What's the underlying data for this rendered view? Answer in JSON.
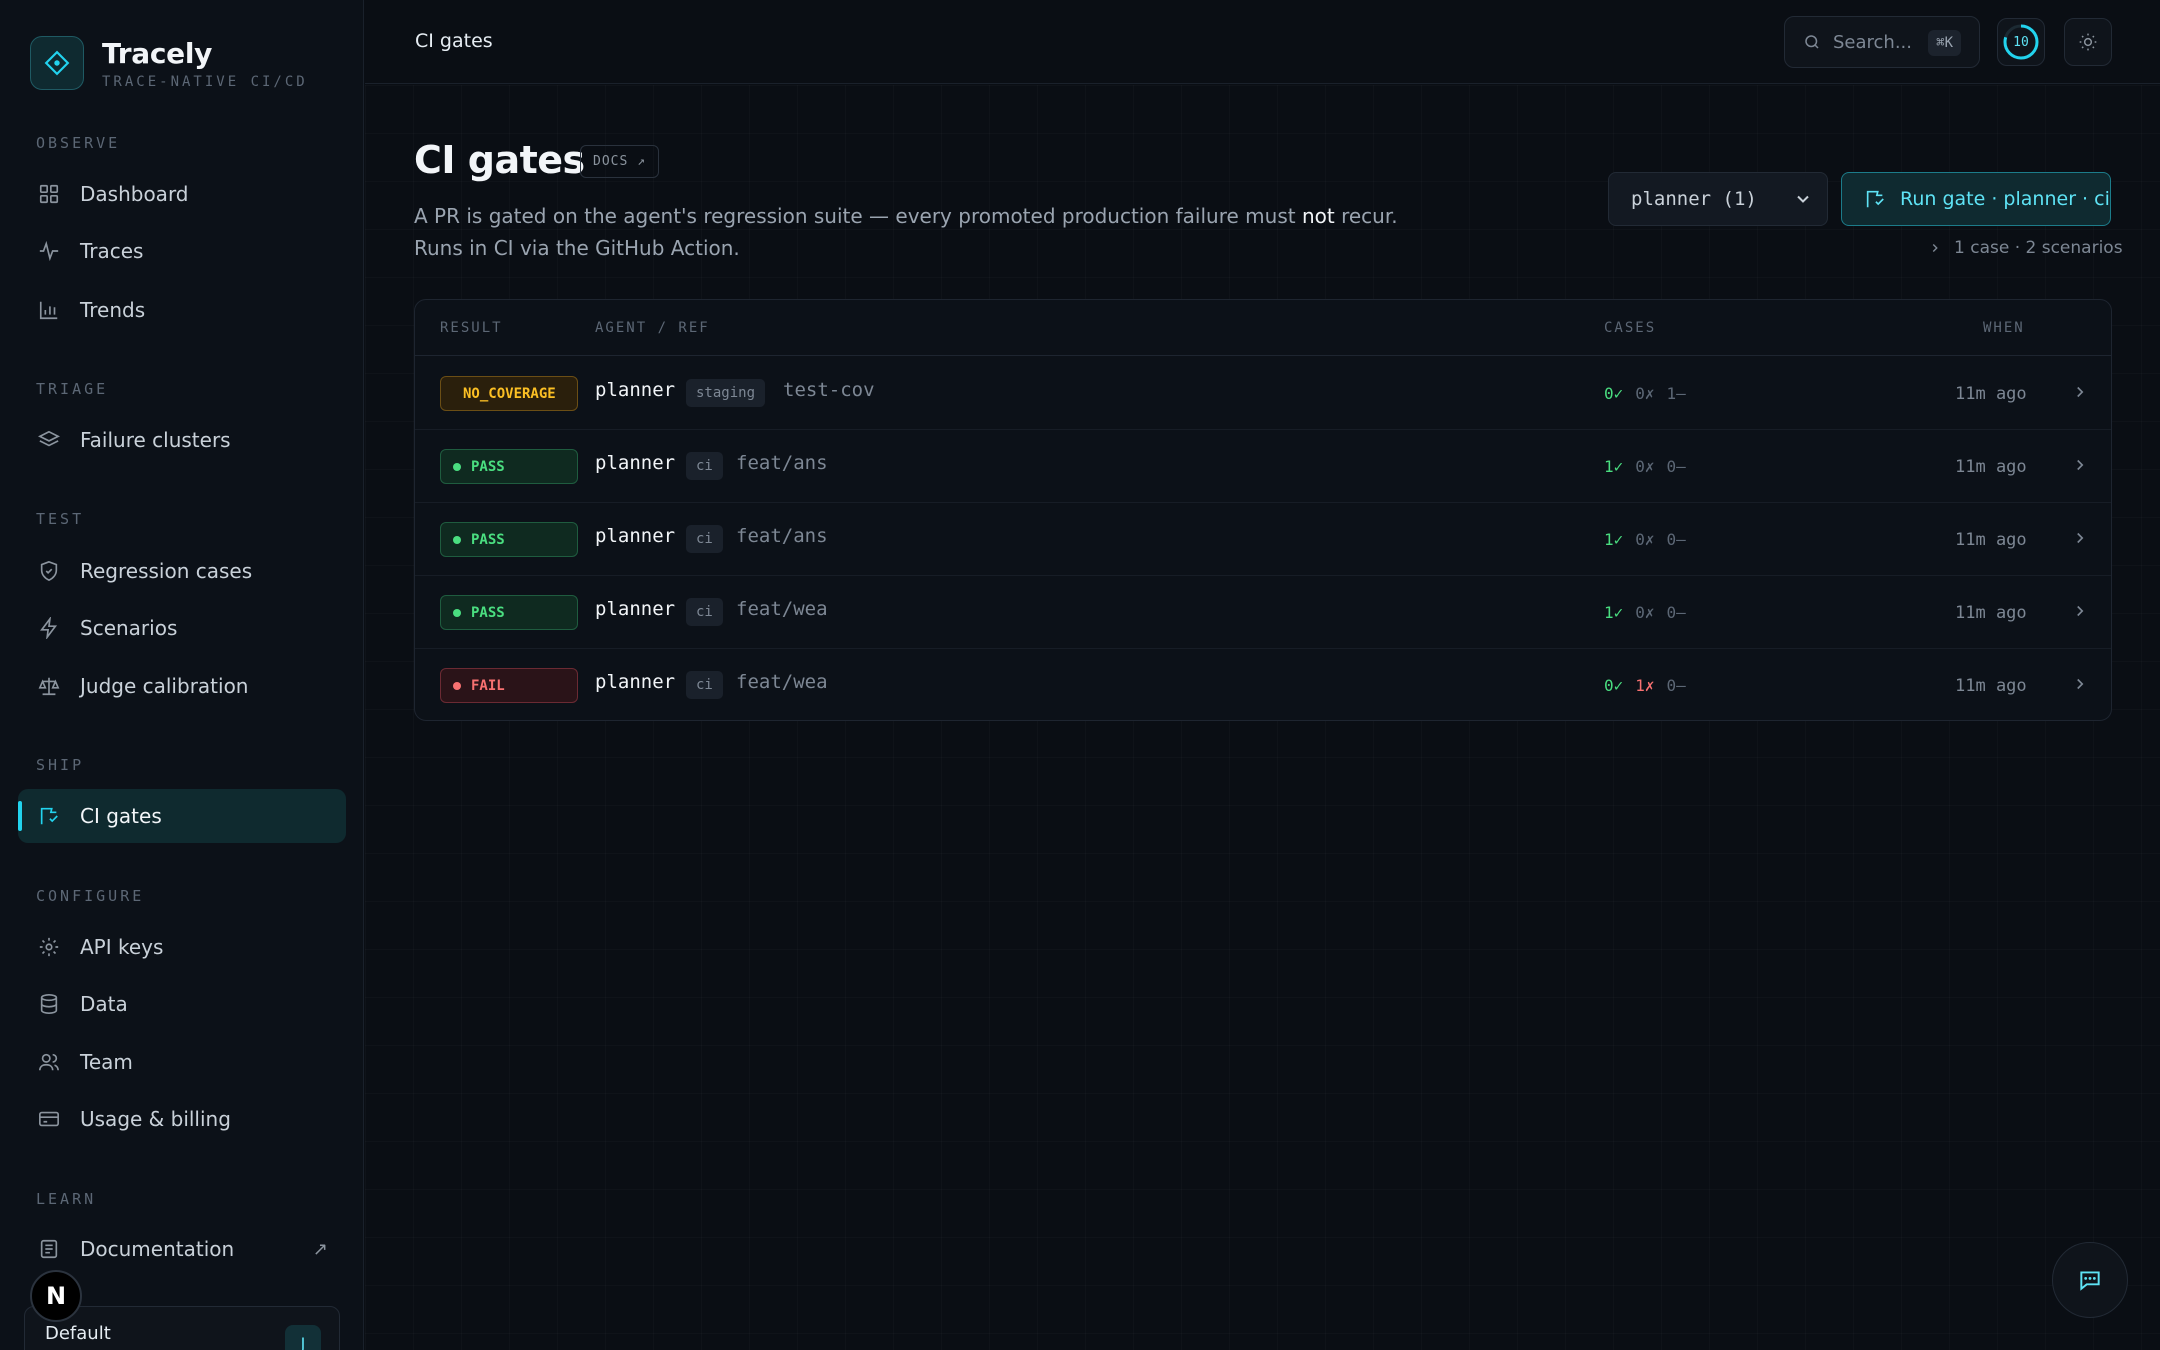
{
  "brand": {
    "name": "Tracely",
    "tagline": "TRACE-NATIVE CI/CD"
  },
  "sidebar": {
    "sections": [
      {
        "label": "OBSERVE",
        "items": [
          {
            "label": "Dashboard",
            "icon": "grid-icon"
          },
          {
            "label": "Traces",
            "icon": "activity-icon"
          },
          {
            "label": "Trends",
            "icon": "bar-chart-icon"
          }
        ]
      },
      {
        "label": "TRIAGE",
        "items": [
          {
            "label": "Failure clusters",
            "icon": "layers-icon"
          }
        ]
      },
      {
        "label": "TEST",
        "items": [
          {
            "label": "Regression cases",
            "icon": "shield-check-icon"
          },
          {
            "label": "Scenarios",
            "icon": "bolt-icon"
          },
          {
            "label": "Judge calibration",
            "icon": "scale-icon"
          }
        ]
      },
      {
        "label": "SHIP",
        "items": [
          {
            "label": "CI gates",
            "icon": "flag-check-icon",
            "active": true
          }
        ]
      },
      {
        "label": "CONFIGURE",
        "items": [
          {
            "label": "API keys",
            "icon": "gear-icon"
          },
          {
            "label": "Data",
            "icon": "database-icon"
          },
          {
            "label": "Team",
            "icon": "users-icon"
          },
          {
            "label": "Usage & billing",
            "icon": "credit-card-icon"
          }
        ]
      },
      {
        "label": "LEARN",
        "items": [
          {
            "label": "Documentation",
            "icon": "book-icon",
            "external": "↗"
          }
        ]
      }
    ],
    "workspace": {
      "name": "Default",
      "avatar": "J"
    },
    "n_badge": "N"
  },
  "topbar": {
    "breadcrumb": "CI gates",
    "search_placeholder": "Search...",
    "search_kbd": "⌘K",
    "ring_value": "10"
  },
  "page": {
    "title": "CI gates",
    "docs_label": "DOCS ↗",
    "desc_before": "A PR is gated on the agent's regression suite — every promoted production failure must ",
    "desc_emph": "not",
    "desc_after": " recur. Runs in CI via the GitHub Action.",
    "agent_select": "planner (1)",
    "run_button": "Run gate · planner · ci",
    "run_meta": "1 case · 2 scenarios"
  },
  "table": {
    "headers": {
      "result": "RESULT",
      "agent_ref": "AGENT / REF",
      "cases": "CASES",
      "when": "WHEN"
    },
    "rows": [
      {
        "result": "NO_COVERAGE",
        "status": "cov",
        "agent": "planner",
        "env": "staging",
        "ref": "test-cov",
        "passed": "0✓",
        "failed": "0✗",
        "skipped": "1–",
        "when": "11m ago"
      },
      {
        "result": "PASS",
        "status": "pass",
        "agent": "planner",
        "env": "ci",
        "ref": "feat/ans",
        "passed": "1✓",
        "failed": "0✗",
        "skipped": "0–",
        "when": "11m ago"
      },
      {
        "result": "PASS",
        "status": "pass",
        "agent": "planner",
        "env": "ci",
        "ref": "feat/ans",
        "passed": "1✓",
        "failed": "0✗",
        "skipped": "0–",
        "when": "11m ago"
      },
      {
        "result": "PASS",
        "status": "pass",
        "agent": "planner",
        "env": "ci",
        "ref": "feat/wea",
        "passed": "1✓",
        "failed": "0✗",
        "skipped": "0–",
        "when": "11m ago"
      },
      {
        "result": "FAIL",
        "status": "fail",
        "agent": "planner",
        "env": "ci",
        "ref": "feat/wea",
        "passed": "0✓",
        "failed": "1✗",
        "skipped": "0–",
        "when": "11m ago"
      }
    ]
  },
  "colors": {
    "accent": "#22d3ee",
    "pass": "#4ade80",
    "fail": "#f87171",
    "warn": "#fbbf24",
    "background": "#0a0e14"
  }
}
